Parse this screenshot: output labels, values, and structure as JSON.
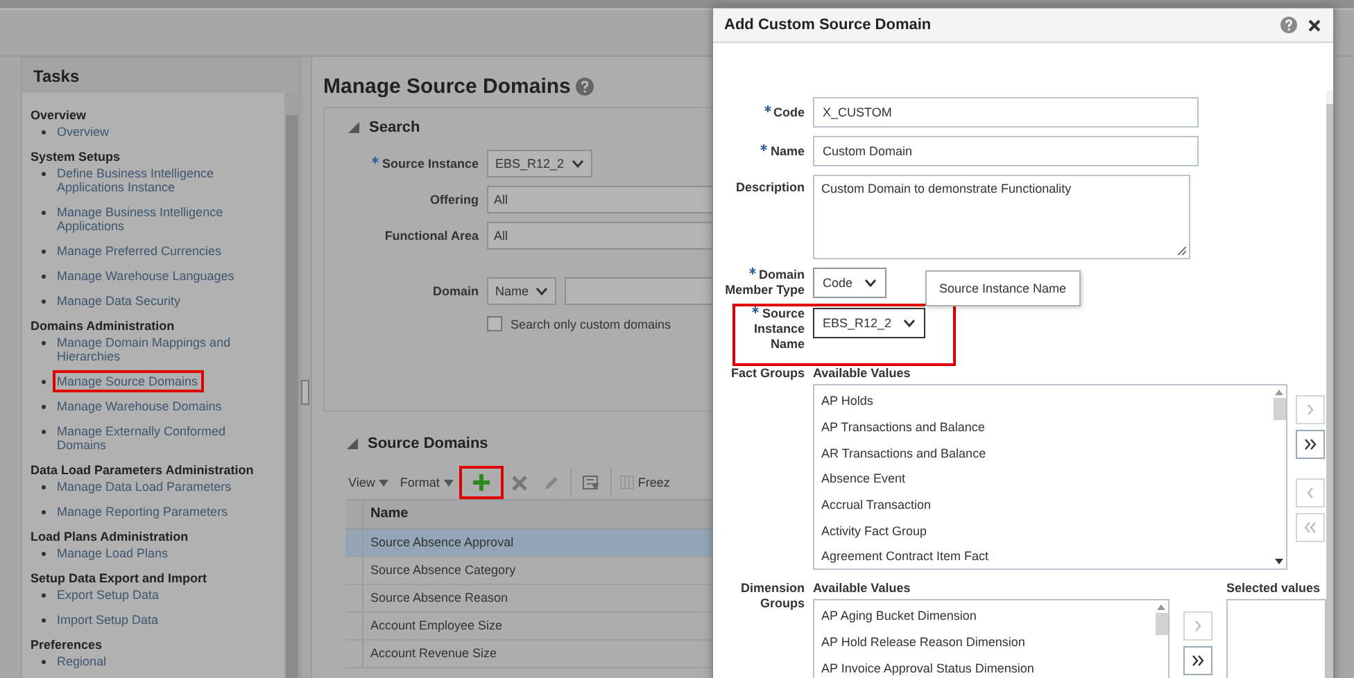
{
  "tasks": {
    "title": "Tasks",
    "sections": [
      {
        "heading": "Overview",
        "items": [
          {
            "label": "Overview",
            "highlighted": false
          }
        ]
      },
      {
        "heading": "System Setups",
        "items": [
          {
            "label": "Define Business Intelligence Applications Instance",
            "highlighted": false
          },
          {
            "label": "Manage Business Intelligence Applications",
            "highlighted": false
          },
          {
            "label": "Manage Preferred Currencies",
            "highlighted": false
          },
          {
            "label": "Manage Warehouse Languages",
            "highlighted": false
          },
          {
            "label": "Manage Data Security",
            "highlighted": false
          }
        ]
      },
      {
        "heading": "Domains Administration",
        "items": [
          {
            "label": "Manage Domain Mappings and Hierarchies",
            "highlighted": false
          },
          {
            "label": "Manage Source Domains",
            "highlighted": true
          },
          {
            "label": "Manage Warehouse Domains",
            "highlighted": false
          },
          {
            "label": "Manage Externally Conformed Domains",
            "highlighted": false
          }
        ]
      },
      {
        "heading": "Data Load Parameters Administration",
        "items": [
          {
            "label": "Manage Data Load Parameters",
            "highlighted": false
          },
          {
            "label": "Manage Reporting Parameters",
            "highlighted": false
          }
        ]
      },
      {
        "heading": "Load Plans Administration",
        "items": [
          {
            "label": "Manage Load Plans",
            "highlighted": false
          }
        ]
      },
      {
        "heading": "Setup Data Export and Import",
        "items": [
          {
            "label": "Export Setup Data",
            "highlighted": false
          },
          {
            "label": "Import Setup Data",
            "highlighted": false
          }
        ]
      },
      {
        "heading": "Preferences",
        "items": [
          {
            "label": "Regional",
            "highlighted": false
          }
        ]
      }
    ]
  },
  "main": {
    "title": "Manage Source Domains",
    "search": {
      "title": "Search",
      "expanded": true,
      "fields": [
        {
          "label": "Source Instance",
          "required": true,
          "kind": "select",
          "value": "EBS_R12_2"
        },
        {
          "label": "Offering",
          "required": false,
          "kind": "text",
          "value": "All"
        },
        {
          "label": "Functional Area",
          "required": false,
          "kind": "text",
          "value": "All"
        },
        {
          "label": "Domain",
          "required": false,
          "kind": "select-text",
          "value": "Name"
        }
      ],
      "checkbox": {
        "label": "Search only custom domains",
        "checked": false
      }
    },
    "table": {
      "title": "Source Domains",
      "expanded": true,
      "toolbar": {
        "view": "View",
        "format": "Format",
        "freeze": "Freez",
        "add_highlighted": true
      },
      "columns": [
        "Name"
      ],
      "rows": [
        {
          "name": "Source Absence Approval",
          "selected": true
        },
        {
          "name": "Source Absence Category",
          "selected": false
        },
        {
          "name": "Source Absence Reason",
          "selected": false
        },
        {
          "name": "Account Employee Size",
          "selected": false
        },
        {
          "name": "Account Revenue Size",
          "selected": false
        }
      ]
    }
  },
  "dialog": {
    "title": "Add Custom Source Domain",
    "fields": [
      {
        "label": "Code",
        "required": true,
        "kind": "text",
        "value": "X_CUSTOM",
        "highlighted": false
      },
      {
        "label": "Name",
        "required": true,
        "kind": "text",
        "value": "Custom Domain",
        "highlighted": false
      },
      {
        "label": "Description",
        "required": false,
        "kind": "textarea",
        "value": "Custom Domain to demonstrate Functionality",
        "highlighted": false
      },
      {
        "label": "Domain Member Type",
        "required": true,
        "kind": "select",
        "value": "Code",
        "highlighted": false
      },
      {
        "label": "Source Instance Name",
        "required": true,
        "kind": "select",
        "value": "EBS_R12_2",
        "highlighted": true
      }
    ],
    "tooltip": "Source Instance Name",
    "fact_groups": {
      "label": "Fact Groups",
      "available_label": "Available Values",
      "items": [
        "AP Holds",
        "AP Transactions and Balance",
        "AR Transactions and Balance",
        "Absence Event",
        "Accrual Transaction",
        "Activity Fact Group",
        "Agreement Contract Item Fact"
      ]
    },
    "dimension_groups": {
      "label": "Dimension Groups",
      "available_label": "Available Values",
      "selected_label": "Selected values",
      "items": [
        "AP Aging Bucket Dimension",
        "AP Hold Release Reason Dimension",
        "AP Invoice Approval Status Dimension"
      ]
    }
  }
}
